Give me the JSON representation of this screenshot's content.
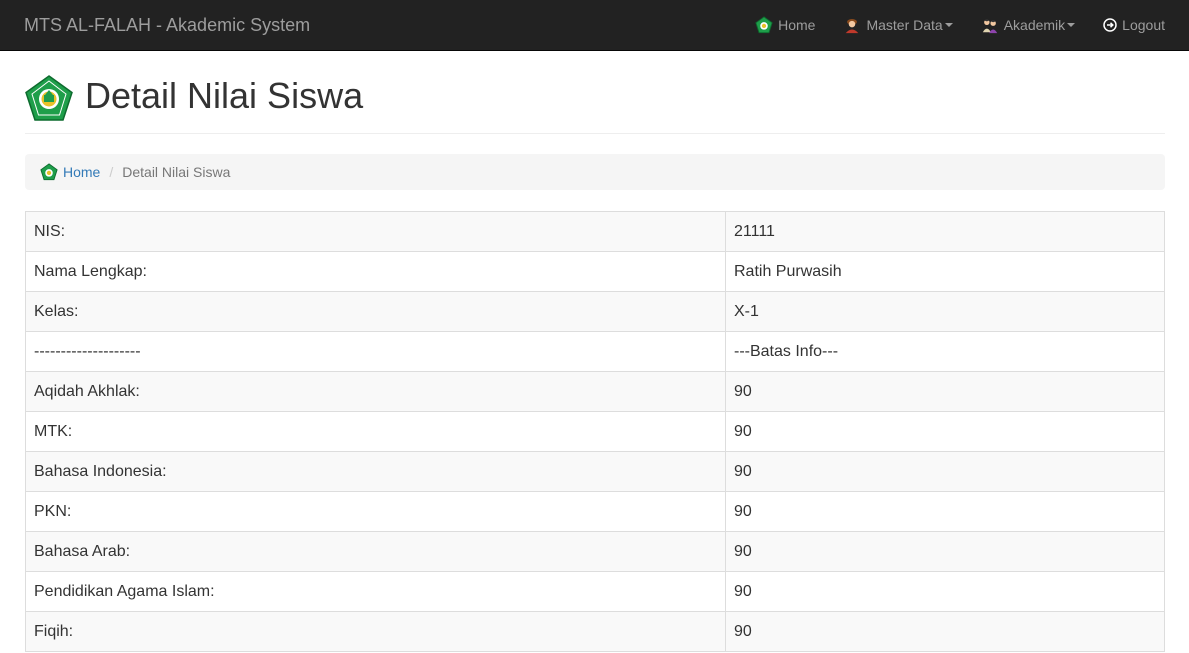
{
  "navbar": {
    "brand": "MTS AL-FALAH - Akademic System",
    "items": [
      {
        "label": "Home",
        "icon": "school-logo-icon"
      },
      {
        "label": "Master Data",
        "icon": "student-icon"
      },
      {
        "label": "Akademik",
        "icon": "students-icon"
      },
      {
        "label": "Logout",
        "icon": "logout-icon"
      }
    ]
  },
  "header": {
    "title": "Detail Nilai Siswa",
    "icon": "school-logo-icon"
  },
  "breadcrumb": {
    "home": "Home",
    "separator": "/",
    "current": "Detail Nilai Siswa"
  },
  "detail": {
    "rows": [
      {
        "label": "NIS:",
        "value": "21111"
      },
      {
        "label": "Nama Lengkap:",
        "value": "Ratih Purwasih"
      },
      {
        "label": "Kelas:",
        "value": "X-1"
      },
      {
        "label": "--------------------",
        "value": "---Batas Info---"
      },
      {
        "label": "Aqidah Akhlak:",
        "value": "90"
      },
      {
        "label": "MTK:",
        "value": "90"
      },
      {
        "label": "Bahasa Indonesia:",
        "value": "90"
      },
      {
        "label": "PKN:",
        "value": "90"
      },
      {
        "label": "Bahasa Arab:",
        "value": "90"
      },
      {
        "label": "Pendidikan Agama Islam:",
        "value": "90"
      },
      {
        "label": "Fiqih:",
        "value": "90"
      }
    ]
  },
  "colors": {
    "navbar_bg": "#222222",
    "nav_text": "#9d9d9d",
    "link": "#337ab7",
    "logo_green": "#1e9e4a",
    "logo_gold": "#e8c22a"
  }
}
